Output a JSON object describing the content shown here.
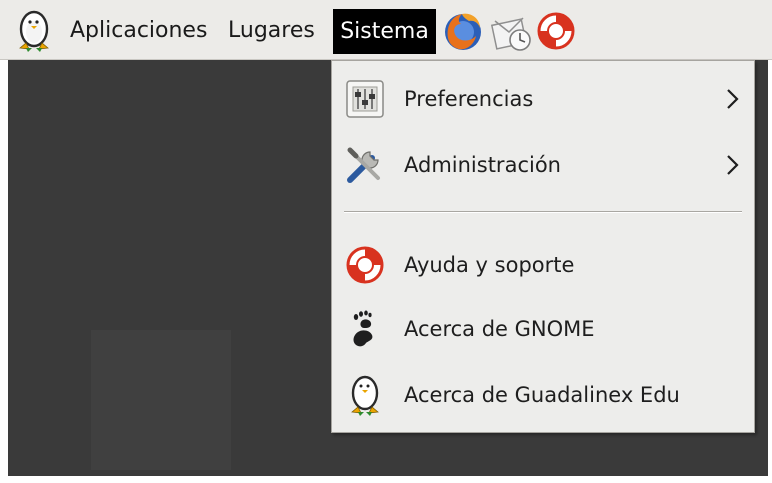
{
  "panel": {
    "menus": {
      "applications": "Aplicaciones",
      "places": "Lugares",
      "system": "Sistema"
    },
    "logo_icon": "guadalinex-penguin-icon",
    "launchers": [
      {
        "icon": "firefox-icon"
      },
      {
        "icon": "mail-client-icon"
      },
      {
        "icon": "help-lifebuoy-icon"
      }
    ]
  },
  "system_menu": {
    "items": [
      {
        "label": "Preferencias",
        "icon": "preferences-icon",
        "submenu": true
      },
      {
        "label": "Administración",
        "icon": "administration-tools-icon",
        "submenu": true
      },
      {
        "label": "Ayuda y soporte",
        "icon": "help-lifebuoy-icon",
        "submenu": false
      },
      {
        "label": "Acerca de GNOME",
        "icon": "gnome-foot-icon",
        "submenu": false
      },
      {
        "label": "Acerca de Guadalinex Edu",
        "icon": "guadalinex-penguin-icon",
        "submenu": false
      }
    ]
  },
  "colors": {
    "panel_bg": "#ecebe8",
    "selected_menu_bg": "#000000",
    "menu_bg": "#ededeb",
    "desktop_bg": "#3a3a3a",
    "lifebuoy_red": "#d8321f",
    "firefox_orange": "#e8711b"
  }
}
